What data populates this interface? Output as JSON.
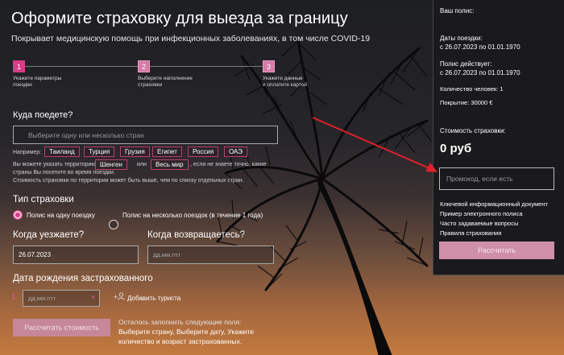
{
  "header": {
    "title": "Оформите страховку для выезда за границу",
    "subtitle": "Покрывает медицинскую помощь при инфекционных заболеваниях, в том числе COVID-19"
  },
  "steps": [
    {
      "num": "1",
      "label_line1": "Укажите параметры",
      "label_line2": "поездки"
    },
    {
      "num": "2",
      "label_line1": "Выберите наполнение",
      "label_line2": "страховки"
    },
    {
      "num": "3",
      "label_line1": "Укажите данные",
      "label_line2": "и оплатите картой"
    }
  ],
  "destination": {
    "label": "Куда поедете?",
    "placeholder": "Выберите одну или несколько стран",
    "example_prefix": "Например:",
    "chips": [
      "Таиланд",
      "Турция",
      "Грузия",
      "Египет",
      "Россия",
      "ОАЭ"
    ],
    "territory_text_1": "Вы можете указать территорию",
    "territory_chip_1": "Шенген",
    "territory_or": "или",
    "territory_chip_2": "Весь мир",
    "territory_text_2": ", если не знаете точно, какие",
    "territory_text_3": "страны Вы посетите во время поездки.",
    "territory_text_4": "Стоимость страховки по территории может быть выше, чем по списку отдельных стран."
  },
  "insurance_type": {
    "label": "Тип страховки",
    "option_single": "Полис на одну поездку",
    "option_multi": "Полис на несколько поездок (в течение 1 года)"
  },
  "dates": {
    "depart_label": "Когда уезжаете?",
    "depart_value": "26.07.2023",
    "return_label": "Когда возвращаетесь?",
    "return_placeholder": "дд.мм.гггг"
  },
  "birth": {
    "label": "Дата рождения застрахованного",
    "index": "1",
    "placeholder": "дд.мм.гггг",
    "clear": "×",
    "add_tourist": "Добавить туриста",
    "plus": "+"
  },
  "calc_button": "Рассчитать стоимость",
  "hint": {
    "line1": "Осталось заполнить следующие поля:",
    "line2": "Выберите страну, Выберите дату, Укажите",
    "line3": "количество и возраст застрахованных."
  },
  "panel": {
    "heading": "Ваш полис:",
    "trip_label": "Даты поездки:",
    "trip_value": "с 26.07.2023 по 01.01.1970",
    "valid_label": "Полис действует:",
    "valid_value": "с 26.07.2023 по 01.01.1970",
    "people": "Количество человек: 1",
    "coverage": "Покрытие: 30000 €",
    "cost_label": "Стоимость страховки:",
    "cost_value": "0 руб",
    "promo_placeholder": "Промокод, если есть",
    "links": [
      "Ключевой информационный документ",
      "Пример электронного полиса",
      "Часто задаваемые вопросы",
      "Правила страхования"
    ],
    "button": "Рассчитать"
  },
  "colors": {
    "accent": "#d93c86",
    "chip_border": "#c13c6c",
    "panel_bg": "#1a1a1d",
    "arrow": "#e0202a"
  }
}
